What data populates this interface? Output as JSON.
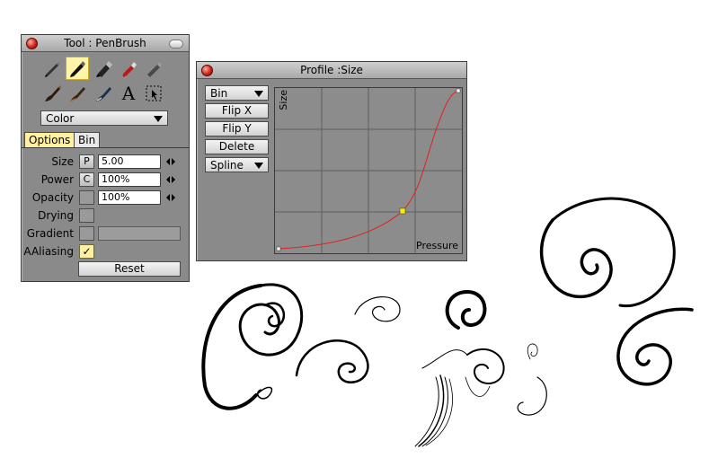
{
  "tool_panel": {
    "title": "Tool : PenBrush",
    "color_dropdown": "Color",
    "tabs": [
      {
        "label": "Options"
      },
      {
        "label": "Bin"
      }
    ],
    "rows": {
      "size": {
        "label": "Size",
        "mode": "P",
        "value": "5.00"
      },
      "power": {
        "label": "Power",
        "mode": "C",
        "value": "100%"
      },
      "opacity": {
        "label": "Opacity",
        "value": "100%"
      },
      "drying": {
        "label": "Drying"
      },
      "gradient": {
        "label": "Gradient"
      },
      "aaliasing": {
        "label": "AAliasing",
        "checked": true,
        "check_glyph": "✓"
      }
    },
    "reset_label": "Reset",
    "brushes": [
      {
        "name": "pencil-icon"
      },
      {
        "name": "pen-icon",
        "selected": true
      },
      {
        "name": "marker-icon"
      },
      {
        "name": "airbrush-icon"
      },
      {
        "name": "crayon-icon"
      },
      {
        "name": "brush-icon"
      },
      {
        "name": "smudge-icon"
      },
      {
        "name": "eraser-icon"
      },
      {
        "name": "text-icon",
        "glyph": "A"
      },
      {
        "name": "selection-icon"
      }
    ]
  },
  "profile_panel": {
    "title": "Profile :Size",
    "buttons": {
      "bin": "Bin",
      "flip_x": "Flip X",
      "flip_y": "Flip Y",
      "delete": "Delete",
      "spline": "Spline"
    },
    "graph": {
      "x_label": "Pressure",
      "y_label": "Size"
    }
  },
  "colors": {
    "panel_bg": "#8a8a8a",
    "highlight": "#fff1a0",
    "curve": "#e02020",
    "control_point": "#ffea00"
  }
}
